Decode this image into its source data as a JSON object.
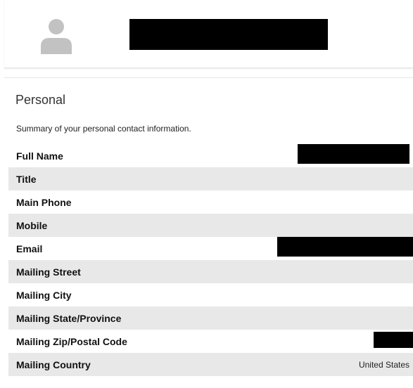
{
  "profile": {
    "avatar_icon": "user-avatar-icon"
  },
  "personal": {
    "title": "Personal",
    "description": "Summary of your personal contact information.",
    "fields": [
      {
        "label": "Full Name",
        "value": ""
      },
      {
        "label": "Title",
        "value": ""
      },
      {
        "label": "Main Phone",
        "value": ""
      },
      {
        "label": "Mobile",
        "value": ""
      },
      {
        "label": "Email",
        "value": ""
      },
      {
        "label": "Mailing Street",
        "value": ""
      },
      {
        "label": "Mailing City",
        "value": ""
      },
      {
        "label": "Mailing State/Province",
        "value": ""
      },
      {
        "label": "Mailing Zip/Postal Code",
        "value": ""
      },
      {
        "label": "Mailing Country",
        "value": "United States"
      }
    ]
  },
  "colors": {
    "row_shade": "#e8e8e8",
    "avatar_gray": "#c2c2c2",
    "redaction": "#000000"
  }
}
